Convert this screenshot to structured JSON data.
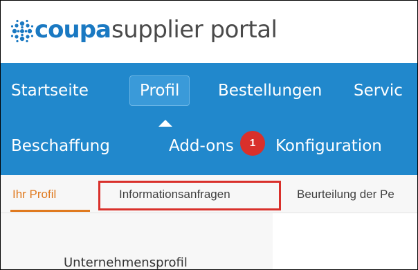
{
  "logo": {
    "brand": "coupa",
    "subtitle": "supplier portal",
    "icon": "coupa-snowflake-icon"
  },
  "nav": {
    "items": [
      {
        "label": "Startseite",
        "active": false
      },
      {
        "label": "Profil",
        "active": true
      },
      {
        "label": "Bestellungen",
        "active": false
      },
      {
        "label": "Servic",
        "active": false
      },
      {
        "label": "Beschaffung",
        "active": false
      },
      {
        "label": "Add-ons",
        "active": false
      },
      {
        "label": "Konfiguration",
        "active": false
      }
    ],
    "badge": {
      "text": "1"
    }
  },
  "subnav": {
    "items": [
      {
        "label": "Ihr Profil",
        "active": true
      },
      {
        "label": "Informationsanfragen",
        "active": false
      },
      {
        "label": "Beurteilung der Pe",
        "active": false
      }
    ]
  },
  "panel": {
    "title": "Unternehmensprofil"
  },
  "colors": {
    "nav_bg": "#2188cc",
    "brand_blue": "#1a79c2",
    "accent_orange": "#e07a1f",
    "highlight_red": "#d9302b"
  }
}
